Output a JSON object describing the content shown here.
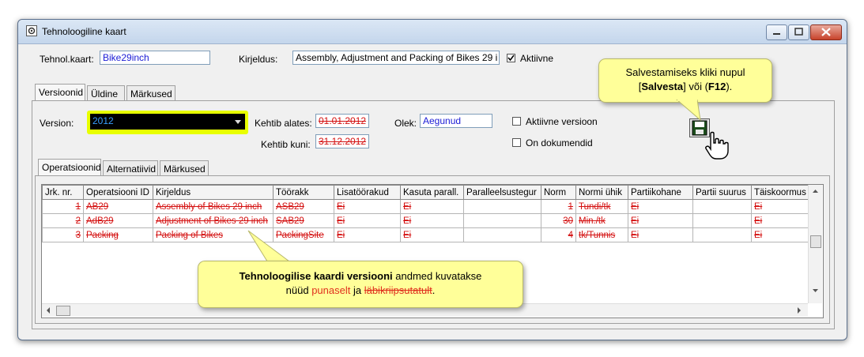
{
  "window": {
    "title": "Tehnoloogiline kaart"
  },
  "header": {
    "tehnol_label": "Tehnol.kaart:",
    "tehnol_value": "Bike29inch",
    "kirjeldus_label": "Kirjeldus:",
    "kirjeldus_value": "Assembly, Adjustment and Packing of Bikes 29 i",
    "aktiivne_label": "Aktiivne"
  },
  "tabs": [
    "Versioonid",
    "Üldine",
    "Märkused"
  ],
  "version": {
    "version_label": "Version:",
    "version_value": "2012",
    "kehtib_alates_label": "Kehtib alates:",
    "kehtib_alates_value": "01.01.2012",
    "kehtib_kuni_label": "Kehtib kuni:",
    "kehtib_kuni_value": "31.12.2012",
    "olek_label": "Olek:",
    "olek_value": "Aegunud",
    "aktiivne_versioon_label": "Aktiivne versioon",
    "on_dokumendid_label": "On dokumendid"
  },
  "subtabs": [
    "Operatsioonid",
    "Alternatiivid",
    "Märkused"
  ],
  "grid": {
    "columns": [
      "Jrk. nr.",
      "Operatsiooni ID",
      "Kirjeldus",
      "Töörakk",
      "Lisatöörakud",
      "Kasuta parall.",
      "Paralleelsustegur",
      "Norm",
      "Normi ühik",
      "Partiikohane",
      "Partii suurus",
      "Täiskoormus"
    ],
    "rows": [
      [
        "1",
        "AB29",
        "Assembly of Bikes 29 inch",
        "ASB29",
        "Ei",
        "Ei",
        "",
        "1",
        "Tundi/tk",
        "Ei",
        "",
        "Ei"
      ],
      [
        "2",
        "AdB29",
        "Adjustment of Bikes 29 inch",
        "SAB29",
        "Ei",
        "Ei",
        "",
        "30",
        "Min./tk",
        "Ei",
        "",
        "Ei"
      ],
      [
        "3",
        "Packing",
        "Packing of Bikes",
        "PackingSite",
        "Ei",
        "Ei",
        "",
        "4",
        "tk/Tunnis",
        "Ei",
        "",
        "Ei"
      ]
    ]
  },
  "callout_save": {
    "line1": "Salvestamiseks kliki nupul",
    "line2_pre": "[",
    "line2_bold": "Salvesta",
    "line2_mid": "] või (",
    "line2_key": "F12",
    "line2_post": ")."
  },
  "callout_info": {
    "bold_part": "Tehnoloogilise  kaardi versiooni",
    "text_part": " andmed kuvatakse",
    "line2_pre": "nüüd ",
    "red_word": "punaselt",
    "line2_mid": " ja ",
    "strike_word": "läbikriipsutatult",
    "line2_post": "."
  },
  "colors": {
    "deleted_row": "#d41111",
    "highlight": "#e8ff00",
    "callout_bg": "#ffff99"
  }
}
